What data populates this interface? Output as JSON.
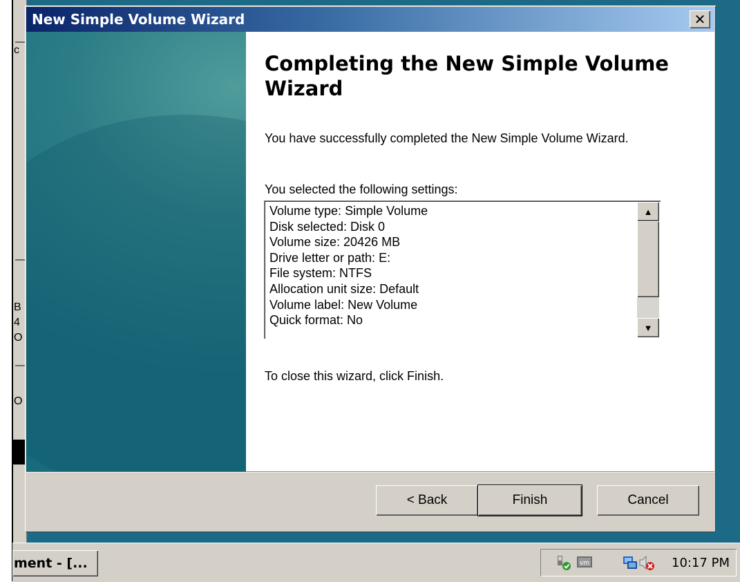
{
  "window": {
    "title": "New Simple Volume Wizard",
    "close_label": "✕"
  },
  "content": {
    "heading": "Completing the New Simple Volume Wizard",
    "intro": "You have successfully completed the New Simple Volume Wizard.",
    "settings_label": "You selected the following settings:",
    "settings": [
      "Volume type: Simple Volume",
      "Disk selected: Disk 0",
      "Volume size: 20426 MB",
      "Drive letter or path: E:",
      "File system: NTFS",
      "Allocation unit size: Default",
      "Volume label: New Volume",
      "Quick format: No"
    ],
    "close_hint": "To close this wizard, click Finish."
  },
  "buttons": {
    "back": "< Back",
    "finish": "Finish",
    "cancel": "Cancel"
  },
  "taskbar": {
    "task_label": "ment - [...",
    "clock": "10:17 PM"
  },
  "background_glyphs": [
    "c",
    "B",
    "4",
    "O",
    "O"
  ],
  "icons": [
    "close-icon",
    "scroll-up-icon",
    "scroll-down-icon",
    "network-icon",
    "vm-icon",
    "connections-icon",
    "volume-muted-icon"
  ],
  "colors": {
    "titlebar_start": "#0a246a",
    "titlebar_end": "#a6caf0",
    "desktop": "#1d6a86",
    "face": "#d4d0c8"
  }
}
